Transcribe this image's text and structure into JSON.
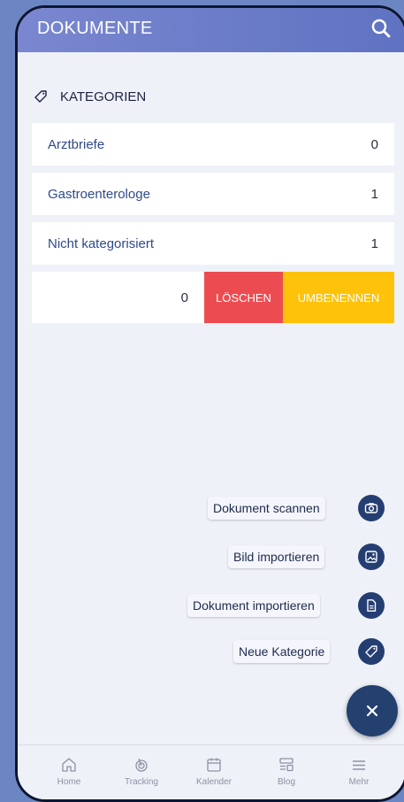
{
  "header": {
    "title": "DOKUMENTE",
    "search_icon": "search-icon"
  },
  "section": {
    "title": "KATEGORIEN",
    "icon": "tag-icon"
  },
  "categories": [
    {
      "label": "Arztbriefe",
      "count": "0"
    },
    {
      "label": "Gastroenterologe",
      "count": "1"
    },
    {
      "label": "Nicht kategorisiert",
      "count": "1"
    }
  ],
  "edit_row": {
    "count": "0",
    "delete_label": "LÖSCHEN",
    "rename_label": "UMBENENNEN"
  },
  "fab_actions": [
    {
      "label": "Dokument scannen",
      "icon": "camera-icon"
    },
    {
      "label": "Bild importieren",
      "icon": "image-icon"
    },
    {
      "label": "Dokument importieren",
      "icon": "document-icon"
    },
    {
      "label": "Neue Kategorie",
      "icon": "tag-icon"
    }
  ],
  "fab_close_icon": "close-icon",
  "tabs": [
    {
      "label": "Home",
      "icon": "home-icon"
    },
    {
      "label": "Tracking",
      "icon": "tracking-icon"
    },
    {
      "label": "Kalender",
      "icon": "calendar-icon"
    },
    {
      "label": "Blog",
      "icon": "blog-icon"
    },
    {
      "label": "Mehr",
      "icon": "menu-icon"
    }
  ],
  "colors": {
    "header_start": "#7a87d0",
    "header_end": "#5f72c1",
    "delete": "#ec4c51",
    "rename": "#ffc20a",
    "fab": "#24406f"
  }
}
